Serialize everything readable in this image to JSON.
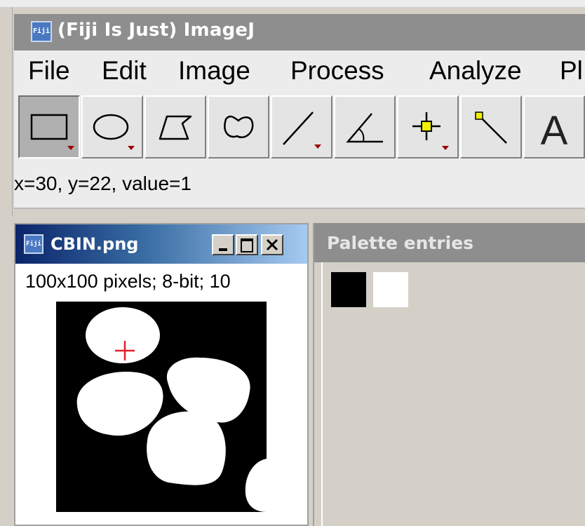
{
  "main_window": {
    "title": "(Fiji Is Just) ImageJ",
    "logo_text": "Fiji",
    "menu": [
      "File",
      "Edit",
      "Image",
      "Process",
      "Analyze",
      "Pl"
    ],
    "tools": [
      {
        "name": "rectangle-tool",
        "selected": true
      },
      {
        "name": "oval-tool",
        "selected": false
      },
      {
        "name": "polygon-tool",
        "selected": false
      },
      {
        "name": "freehand-tool",
        "selected": false
      },
      {
        "name": "line-tool",
        "selected": false
      },
      {
        "name": "angle-tool",
        "selected": false
      },
      {
        "name": "point-tool",
        "selected": false
      },
      {
        "name": "wand-tool",
        "selected": false
      },
      {
        "name": "text-tool",
        "selected": false
      }
    ],
    "text_tool_glyph": "A",
    "status": "x=30, y=22, value=1"
  },
  "image_window": {
    "title": "CBIN.png",
    "logo_text": "Fiji",
    "info": "100x100 pixels; 8-bit; 10",
    "crosshair_color": "#e0202a"
  },
  "palette_window": {
    "title": "Palette entries",
    "swatches": [
      "#000000",
      "#ffffff"
    ]
  },
  "colors": {
    "inactive_titlebar": "#8e8e8e",
    "active_titlebar": "#0a246a",
    "window_bg": "#d4d0c8",
    "menu_bg": "#ececec"
  }
}
